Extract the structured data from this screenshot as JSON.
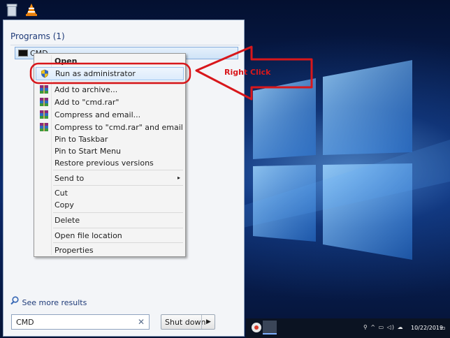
{
  "start_menu": {
    "programs_header": "Programs (1)",
    "program_item": "CMD",
    "see_more": "See more results",
    "search_value": "CMD",
    "search_clear": "✕",
    "shutdown_label": "Shut down",
    "shutdown_arrow": "▶"
  },
  "context_menu": {
    "items": [
      {
        "label": "Open",
        "bold": true
      },
      {
        "label": "Run as administrator",
        "highlighted": true,
        "icon": "uac-shield-icon"
      },
      {
        "label": "Add to archive...",
        "icon": "winrar-icon"
      },
      {
        "label": "Add to \"cmd.rar\"",
        "icon": "winrar-icon"
      },
      {
        "label": "Compress and email...",
        "icon": "winrar-icon"
      },
      {
        "label": "Compress to \"cmd.rar\" and email",
        "icon": "winrar-icon"
      },
      {
        "label": "Pin to Taskbar"
      },
      {
        "label": "Pin to Start Menu"
      },
      {
        "label": "Restore previous versions"
      },
      {
        "label": "Send to",
        "submenu": true
      },
      {
        "label": "Cut"
      },
      {
        "label": "Copy"
      },
      {
        "label": "Delete"
      },
      {
        "label": "Open file location"
      },
      {
        "label": "Properties"
      }
    ],
    "submenu_arrow": "▸"
  },
  "annotation": {
    "text": "Right Click",
    "color": "#d8171b"
  },
  "taskbar": {
    "tray": "⚲ ^ ▭ ◁) ☁",
    "date": "10/22/2019",
    "notify": "▭"
  },
  "colors": {
    "accent": "#1e3a78",
    "highlight_border": "#9cc4ef",
    "annotation": "#d8171b"
  }
}
